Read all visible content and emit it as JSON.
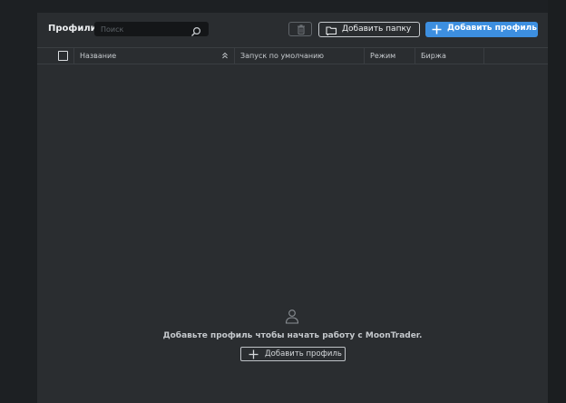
{
  "header": {
    "title": "Профили",
    "search_placeholder": "Поиск",
    "add_folder_label": "Добавить папку",
    "add_profile_label": "Добавить профиль"
  },
  "table": {
    "columns": [
      "Название",
      "Запуск по умолчанию",
      "Режим",
      "Биржа"
    ],
    "rows": []
  },
  "empty_state": {
    "message": "Добавьте профиль чтобы начать работу с MoonTrader.",
    "button_label": "Добавить профиль"
  },
  "colors": {
    "accent": "#3d8fe0",
    "panel": "#2a2d30",
    "background": "#1d2023"
  }
}
